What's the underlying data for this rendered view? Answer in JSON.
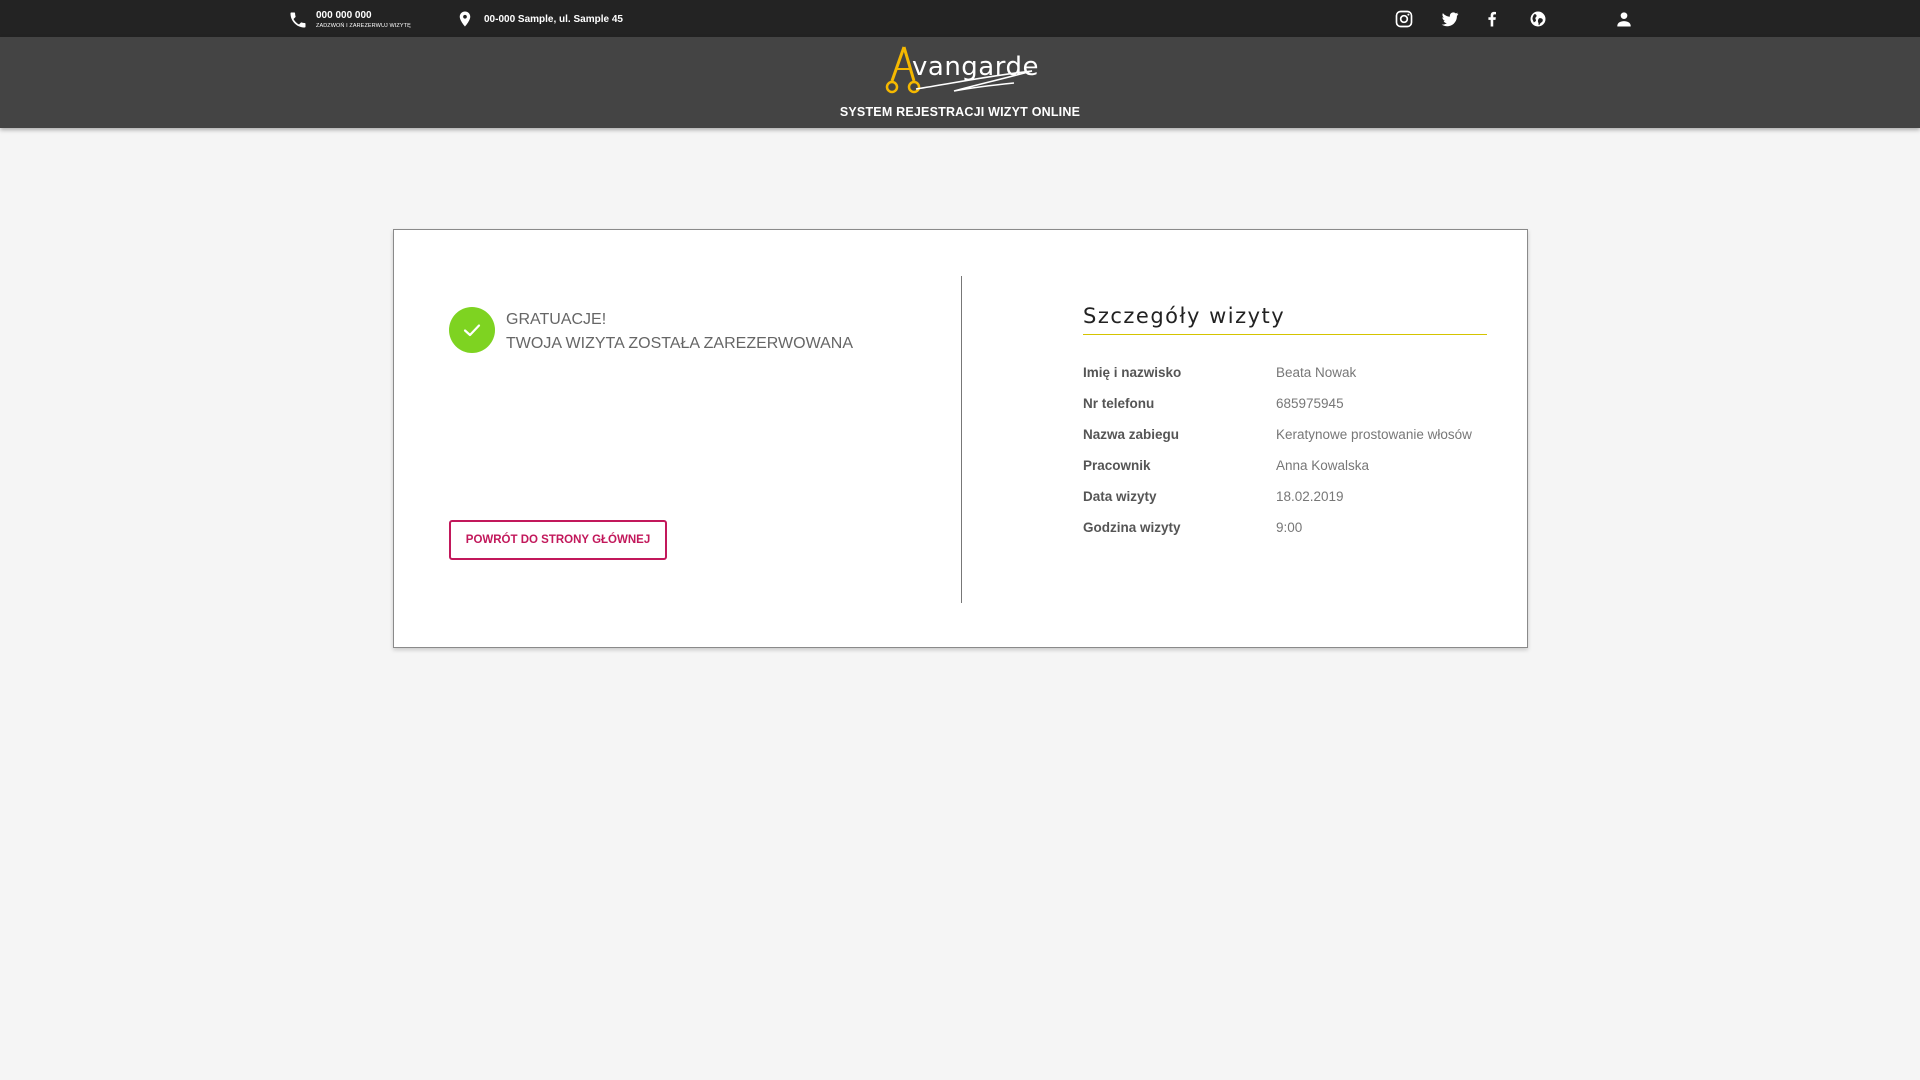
{
  "topbar": {
    "phone": "000 000 000",
    "phone_sub": "zadzwoń i zarezerwuj wizytę",
    "address": "00-000 Sample, ul. Sample 45",
    "social": [
      "instagram-icon",
      "twitter-icon",
      "facebook-icon",
      "globe-icon"
    ],
    "account": "user-icon"
  },
  "brand": {
    "logo_text": "vangarde",
    "subtitle": "SYSTEM REJESTRACJI WIZYT ONLINE",
    "accent": "#f5b800"
  },
  "confirmation": {
    "line1": "GRATUACJE!",
    "line2": "TWOJA WIZYTA ZOSTAŁA ZAREZERWOWANA",
    "button": "POWRÓT DO STRONY GŁÓWNEJ",
    "check_color": "#7ed321",
    "button_color": "#c2185b"
  },
  "details": {
    "title": "Szczegóły wizyty",
    "rows": [
      {
        "label": "Imię i nazwisko",
        "value": "Beata Nowak"
      },
      {
        "label": "Nr telefonu",
        "value": "685975945"
      },
      {
        "label": "Nazwa zabiegu",
        "value": "Keratynowe prostowanie włosów"
      },
      {
        "label": "Pracownik",
        "value": "Anna Kowalska"
      },
      {
        "label": "Data wizyty",
        "value": "18.02.2019"
      },
      {
        "label": "Godzina wizyty",
        "value": "9:00"
      }
    ]
  }
}
